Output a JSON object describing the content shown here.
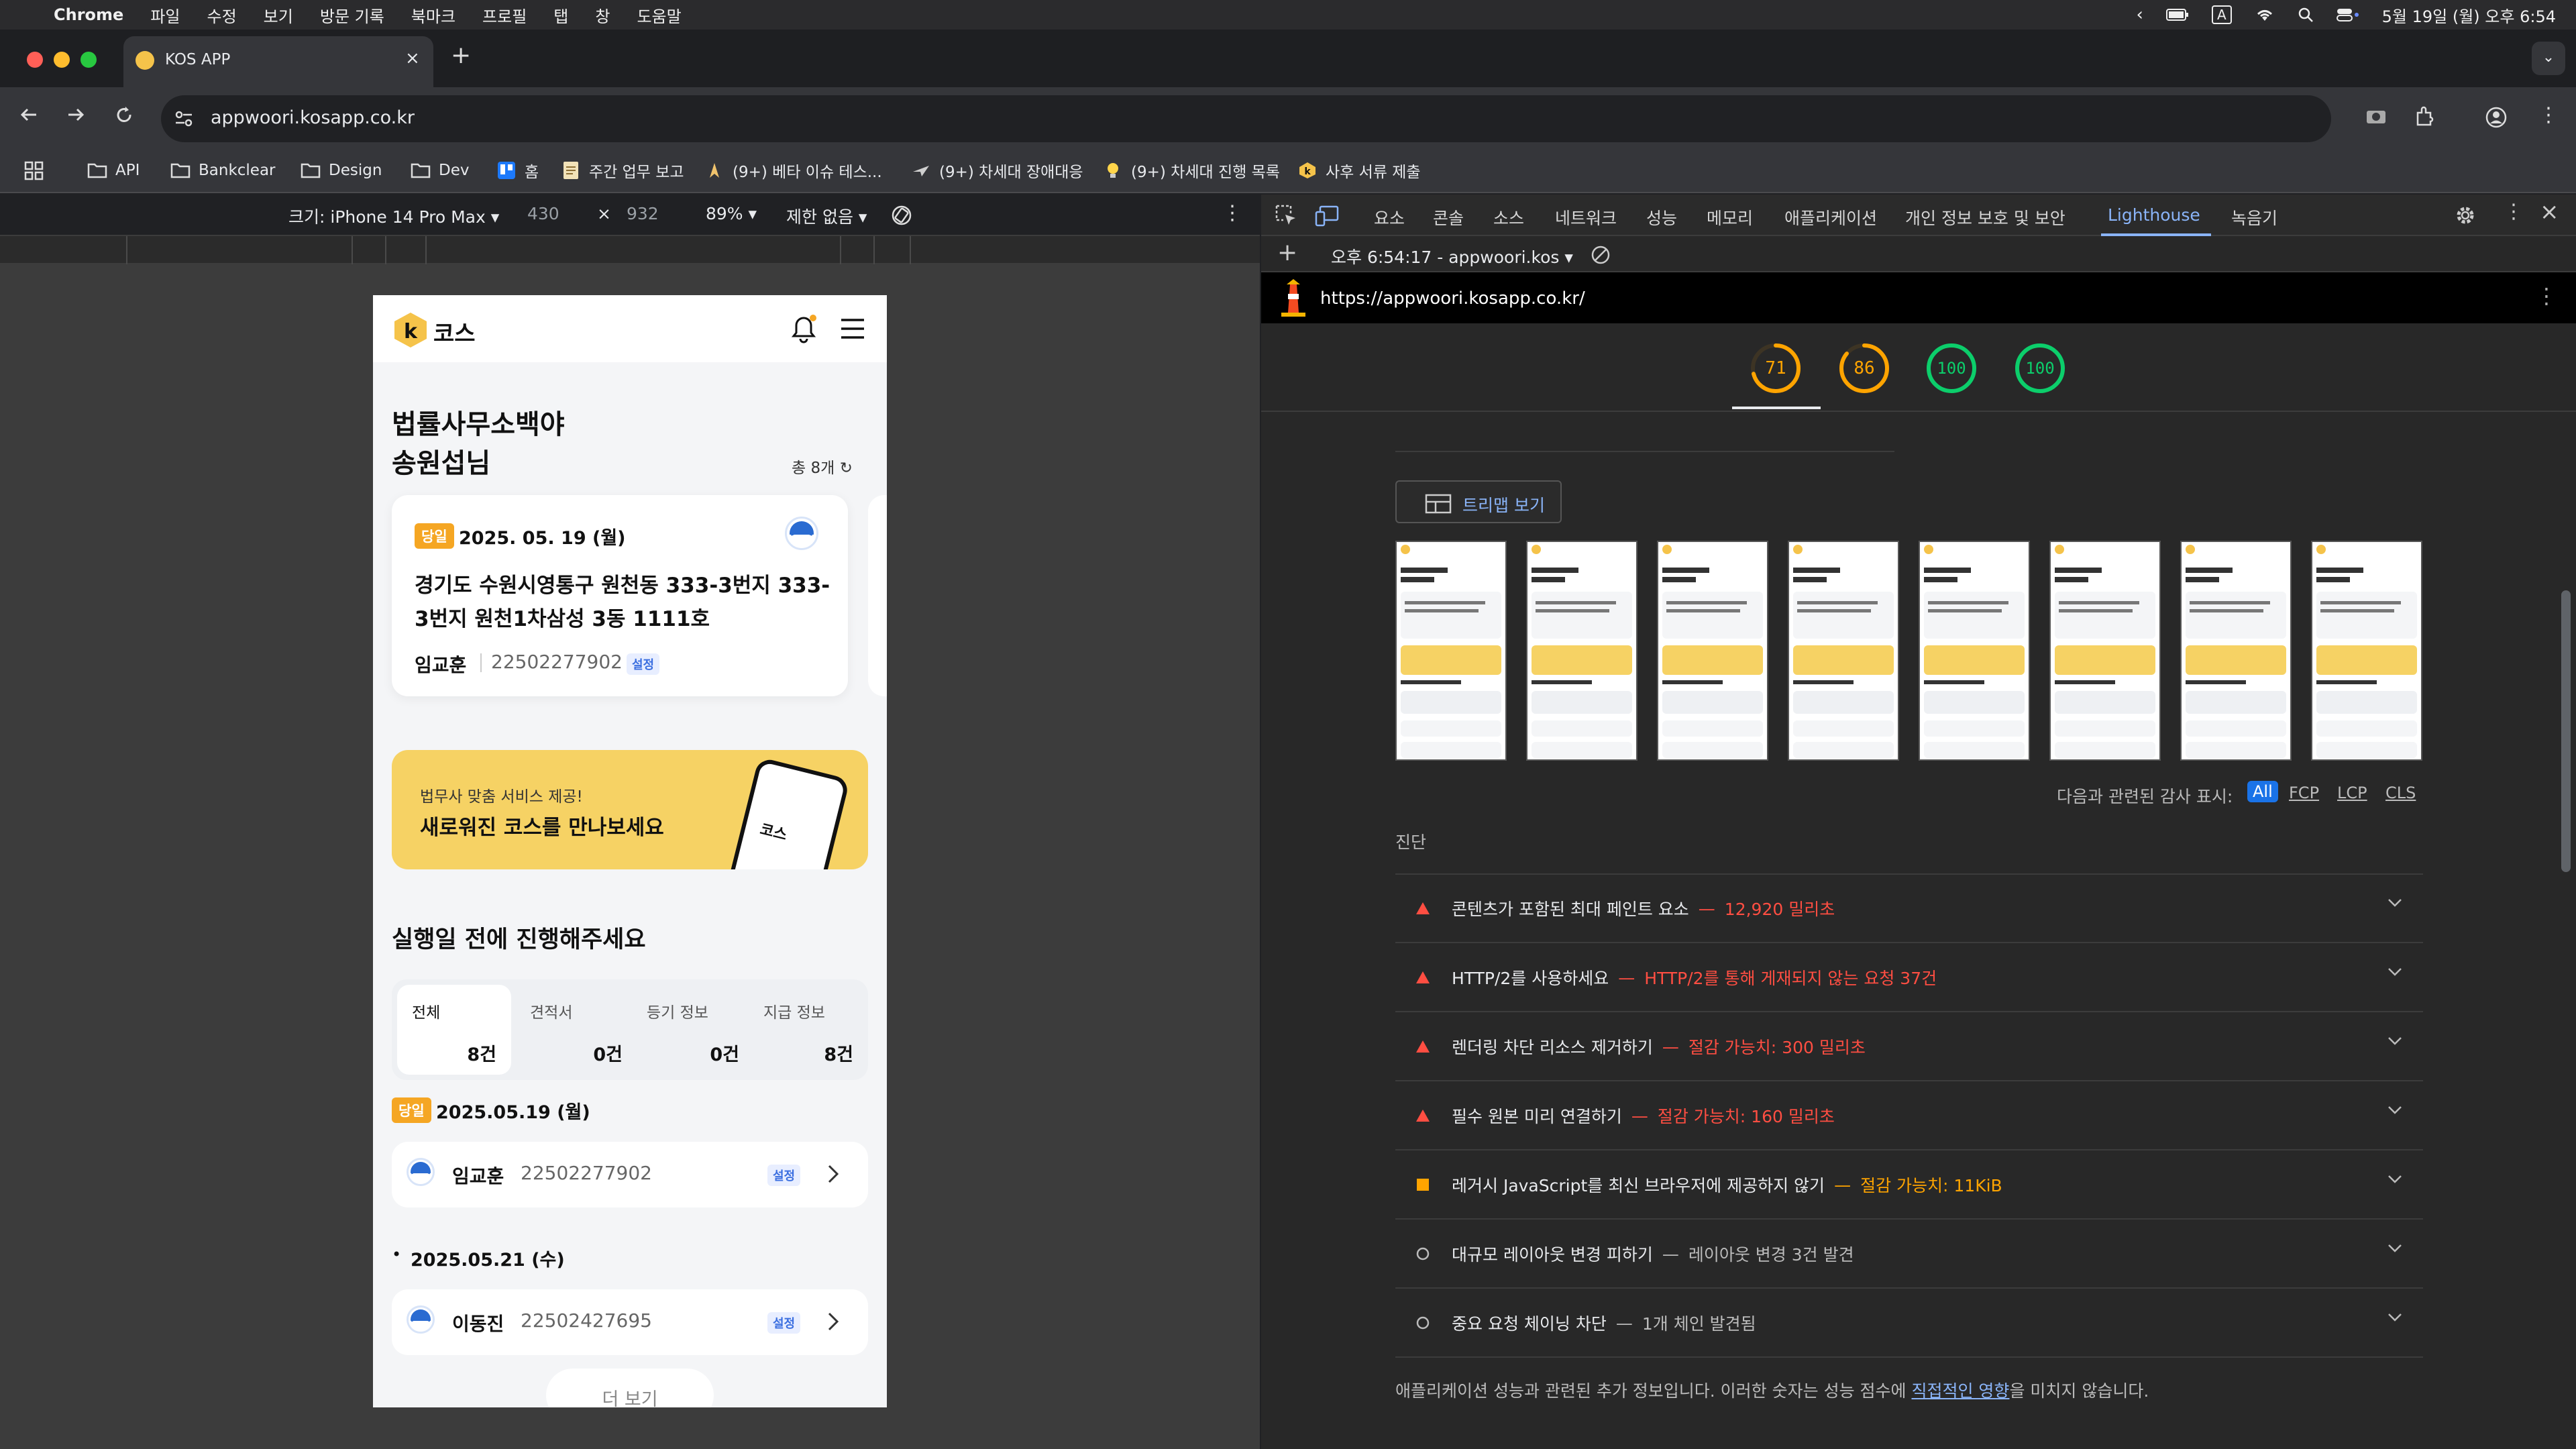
{
  "menubar": {
    "app": "Chrome",
    "items": [
      "파일",
      "수정",
      "보기",
      "방문 기록",
      "북마크",
      "프로필",
      "탭",
      "창",
      "도움말"
    ],
    "clock": "5월 19일 (월) 오후 6:54",
    "input_indicator": "A"
  },
  "browser": {
    "tab_title": "KOS APP",
    "url": "appwoori.kosapp.co.kr",
    "bookmarks": [
      "API",
      "Bankclear",
      "Design",
      "Dev",
      "홈",
      "주간 업무 보고",
      "(9+) 베타 이슈 테스...",
      "(9+) 차세대 장애대응",
      "(9+) 차세대 진행 목록",
      "사후 서류 제출"
    ]
  },
  "device_toolbar": {
    "size_label": "크기: iPhone 14 Pro Max",
    "width": "430",
    "times": "×",
    "height": "932",
    "zoom": "89%",
    "throttle": "제한 없음"
  },
  "app": {
    "logo_text": "코스",
    "greeting_line1": "법률사무소백야",
    "greeting_line2": "송원섭님",
    "total_count": "총 8개",
    "card": {
      "tag": "당일",
      "date": "2025. 05. 19 (월)",
      "address": "경기도 수원시영통구 원천동  333-3번지 333-3번지 원천1차삼성 3동 1111호",
      "person": "임교훈",
      "number": "22502277902",
      "badge": "설정"
    },
    "banner": {
      "sub": "법무사 맞춤 서비스 제공!",
      "main": "새로워진 코스를 만나보세요",
      "phone_logo": "코스"
    },
    "section_title": "실행일 전에 진행해주세요",
    "filters": [
      {
        "label": "전체",
        "count": "8건"
      },
      {
        "label": "견적서",
        "count": "0건"
      },
      {
        "label": "등기 정보",
        "count": "0건"
      },
      {
        "label": "지급 정보",
        "count": "8건"
      }
    ],
    "groups": [
      {
        "tag": "당일",
        "date": "2025.05.19 (월)",
        "name": "임교훈",
        "number": "22502277902",
        "badge": "설정"
      },
      {
        "tag": "•",
        "date": "2025.05.21 (수)",
        "name": "이동진",
        "number": "22502427695",
        "badge": "설정"
      }
    ],
    "more": "더 보기"
  },
  "devtools": {
    "tabs": [
      "요소",
      "콘솔",
      "소스",
      "네트워크",
      "성능",
      "메모리",
      "애플리케이션",
      "개인 정보 보호 및 보안",
      "Lighthouse",
      "녹음기"
    ],
    "active_tab": "Lighthouse",
    "report_selector": "오후 6:54:17 - appwoori.kos",
    "report_url": "https://appwoori.kosapp.co.kr/",
    "scores": [
      {
        "value": "71",
        "color": "#ffa400"
      },
      {
        "value": "86",
        "color": "#ffa400"
      },
      {
        "value": "100",
        "color": "#0cce6b"
      },
      {
        "value": "100",
        "color": "#0cce6b"
      }
    ],
    "treemap_button": "트리맵 보기",
    "audit_filter_label": "다음과 관련된 감사 표시:",
    "audit_filters": [
      "All",
      "FCP",
      "LCP",
      "CLS"
    ],
    "diagnostics_title": "진단",
    "diagnostics": [
      {
        "level": "fail",
        "title": "콘텐츠가 포함된 최대 페인트 요소",
        "detail": "12,920 밀리초"
      },
      {
        "level": "fail",
        "title": "HTTP/2를 사용하세요",
        "detail": "HTTP/2를 통해 게재되지 않는 요청 37건"
      },
      {
        "level": "fail",
        "title": "렌더링 차단 리소스 제거하기",
        "detail": "절감 가능치: 300 밀리초"
      },
      {
        "level": "fail",
        "title": "필수 원본 미리 연결하기",
        "detail": "절감 가능치: 160 밀리초"
      },
      {
        "level": "average",
        "title": "레거시 JavaScript를 최신 브라우저에 제공하지 않기",
        "detail": "절감 가능치: 11KiB"
      },
      {
        "level": "info",
        "title": "대규모 레이아웃 변경 피하기",
        "detail": "레이아웃 변경 3건 발견"
      },
      {
        "level": "info",
        "title": "중요 요청 체이닝 차단",
        "detail": "1개 체인 발견됨"
      }
    ],
    "footer_text": "애플리케이션 성능과 관련된 추가 정보입니다. 이러한 숫자는 성능 점수에 ",
    "footer_link": "직접적인 영향",
    "footer_tail": "을 미치지 않습니다.",
    "colors": {
      "fail": "#ff4e42",
      "average": "#ffa400",
      "pass": "#0cce6b",
      "link": "#8ab4f8",
      "accent": "#f5c34a"
    }
  }
}
